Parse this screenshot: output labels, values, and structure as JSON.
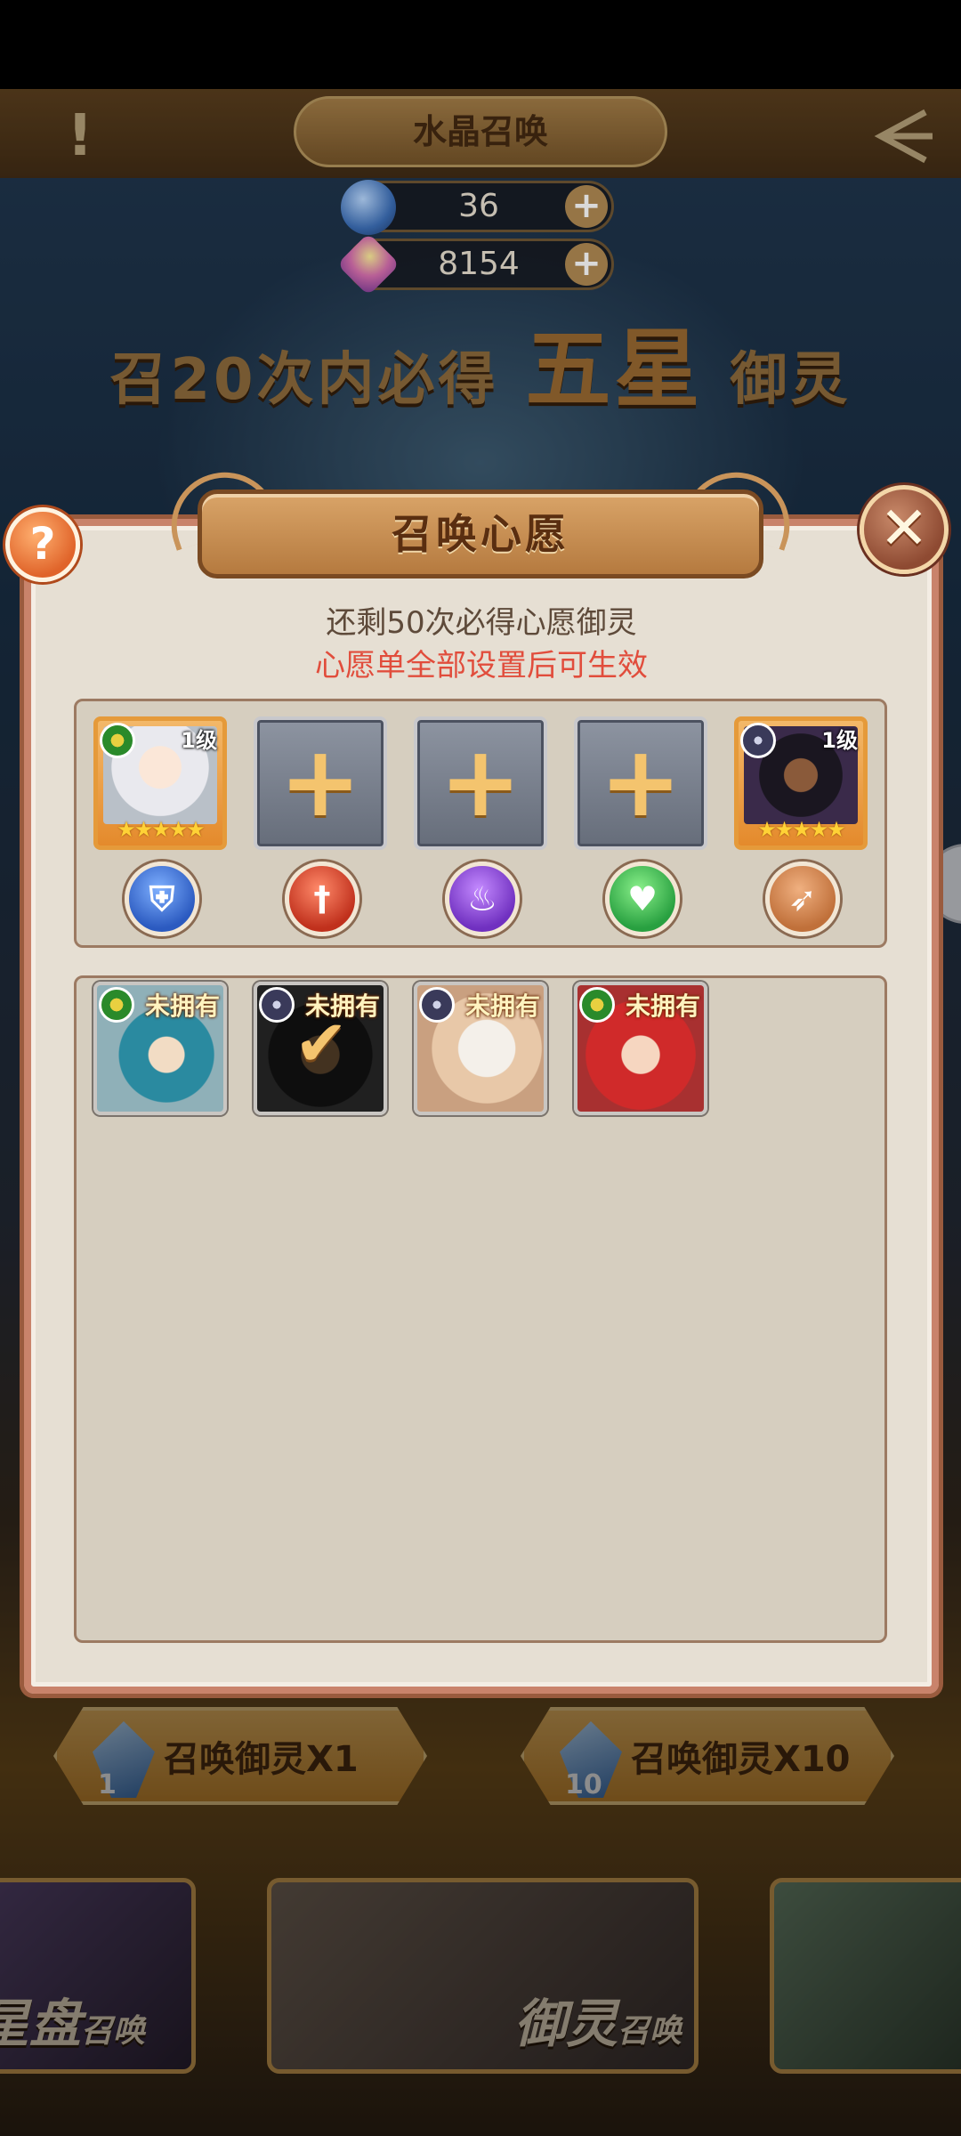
{
  "screen": {
    "title": "水晶召唤",
    "alert_symbol": "!",
    "currencies": [
      {
        "icon": "blue-crystal-icon",
        "value": "36"
      },
      {
        "icon": "gem-icon",
        "value": "8154"
      }
    ],
    "promo": {
      "prefix": "召20次内必得",
      "highlight": "五星",
      "suffix": "御灵"
    }
  },
  "modal": {
    "title": "召唤心愿",
    "help_symbol": "?",
    "close_symbol": "✕",
    "remaining_text": "还剩50次必得心愿御灵",
    "hint_text": "心愿单全部设置后可生效",
    "wish_slots": [
      {
        "state": "filled",
        "level": "1级",
        "stars": "★★★★★",
        "faction": "green",
        "role_icon": "shield-icon"
      },
      {
        "state": "empty",
        "plus": "+",
        "role_icon": "sword-icon"
      },
      {
        "state": "empty",
        "plus": "+",
        "role_icon": "flame-icon"
      },
      {
        "state": "empty",
        "plus": "+",
        "role_icon": "heart-icon"
      },
      {
        "state": "filled",
        "level": "1级",
        "stars": "★★★★★",
        "faction": "dark",
        "role_icon": "bow-icon"
      }
    ],
    "heroes": [
      {
        "tag": "未拥有",
        "faction": "green",
        "selected": false
      },
      {
        "tag": "未拥有",
        "faction": "dark",
        "selected": true
      },
      {
        "tag": "未拥有",
        "faction": "dark",
        "selected": false
      },
      {
        "tag": "未拥有",
        "faction": "green",
        "selected": false
      }
    ],
    "check_symbol": "✔"
  },
  "summon_buttons": [
    {
      "label": "召唤御灵X1",
      "cost": "1"
    },
    {
      "label": "召唤御灵X10",
      "cost": "10"
    }
  ],
  "bottom_tabs": [
    {
      "label_big": "星盘",
      "label_small": "召唤"
    },
    {
      "label_big": "御灵",
      "label_small": "召唤"
    }
  ],
  "colors": {
    "accent_red": "#e14d3c",
    "frame_brown": "#9a5b3e",
    "gold": "#f4c46e"
  }
}
